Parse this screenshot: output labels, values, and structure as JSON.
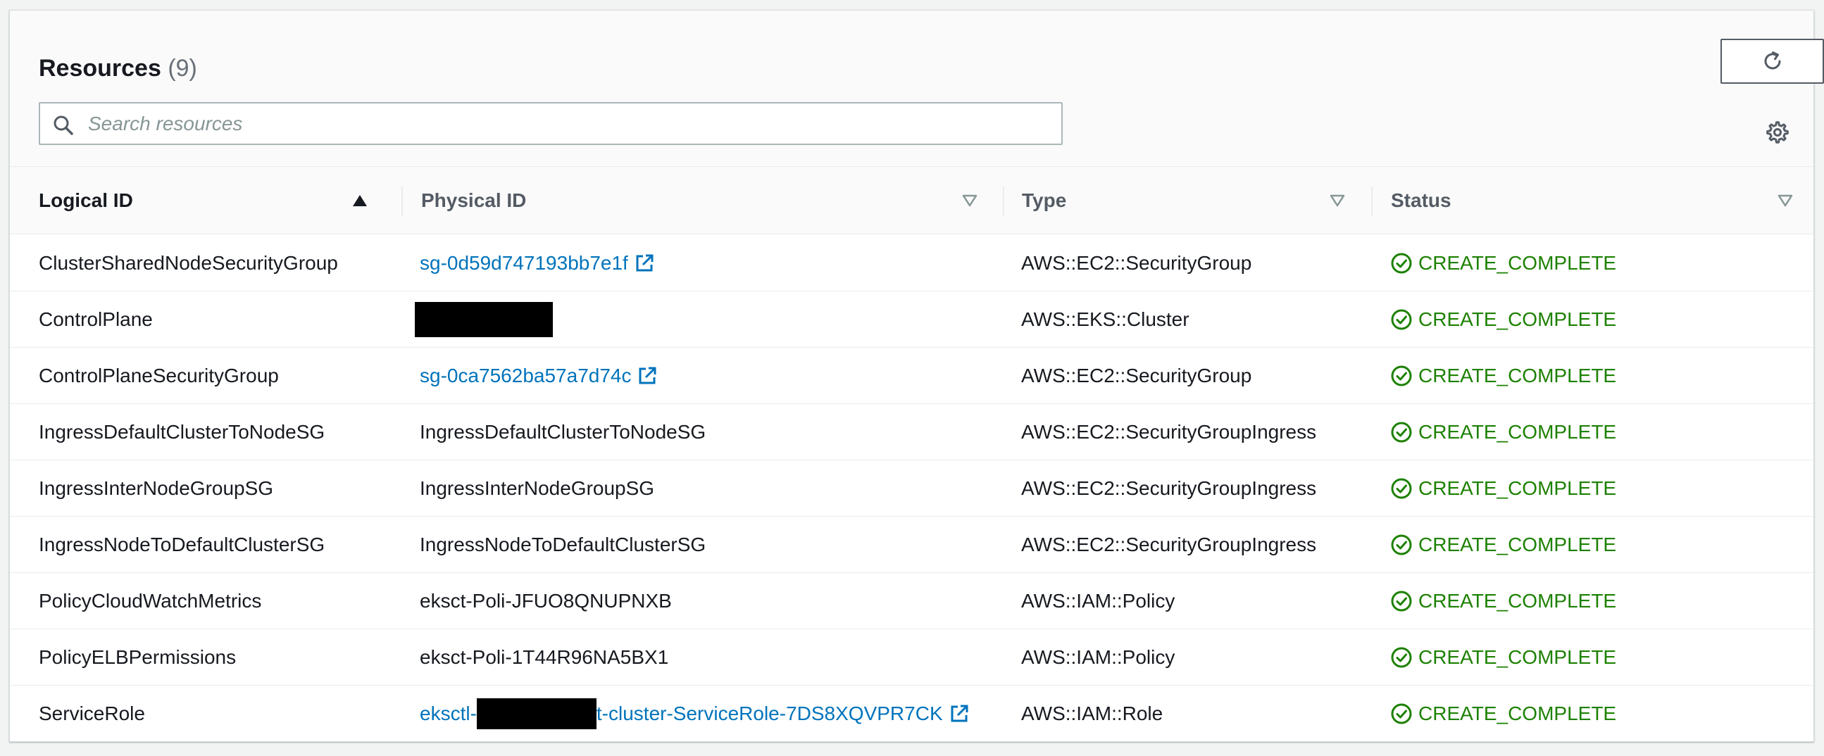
{
  "header": {
    "title": "Resources",
    "count": "(9)"
  },
  "search": {
    "placeholder": "Search resources",
    "value": ""
  },
  "columns": [
    {
      "label": "Logical ID",
      "sort": "ascending"
    },
    {
      "label": "Physical ID",
      "sort": "none"
    },
    {
      "label": "Type",
      "sort": "none"
    },
    {
      "label": "Status",
      "sort": "none"
    }
  ],
  "icons": {
    "refresh": "refresh-icon",
    "search": "search-icon",
    "settings": "gear-icon",
    "external": "external-link-icon",
    "status": "check-circle-icon"
  },
  "colors": {
    "link": "#0073bb",
    "success": "#1d8102"
  },
  "rows": [
    {
      "logical_id": "ClusterSharedNodeSecurityGroup",
      "physical_prefix": "sg-0d59d747193bb7e1f",
      "physical_suffix": "",
      "link": true,
      "redacted": false,
      "type": "AWS::EC2::SecurityGroup",
      "status": "CREATE_COMPLETE"
    },
    {
      "logical_id": "ControlPlane",
      "physical_prefix": "",
      "physical_suffix": "",
      "link": false,
      "redacted": true,
      "type": "AWS::EKS::Cluster",
      "status": "CREATE_COMPLETE"
    },
    {
      "logical_id": "ControlPlaneSecurityGroup",
      "physical_prefix": "sg-0ca7562ba57a7d74c",
      "physical_suffix": "",
      "link": true,
      "redacted": false,
      "type": "AWS::EC2::SecurityGroup",
      "status": "CREATE_COMPLETE"
    },
    {
      "logical_id": "IngressDefaultClusterToNodeSG",
      "physical_prefix": "IngressDefaultClusterToNodeSG",
      "physical_suffix": "",
      "link": false,
      "redacted": false,
      "type": "AWS::EC2::SecurityGroupIngress",
      "status": "CREATE_COMPLETE"
    },
    {
      "logical_id": "IngressInterNodeGroupSG",
      "physical_prefix": "IngressInterNodeGroupSG",
      "physical_suffix": "",
      "link": false,
      "redacted": false,
      "type": "AWS::EC2::SecurityGroupIngress",
      "status": "CREATE_COMPLETE"
    },
    {
      "logical_id": "IngressNodeToDefaultClusterSG",
      "physical_prefix": "IngressNodeToDefaultClusterSG",
      "physical_suffix": "",
      "link": false,
      "redacted": false,
      "type": "AWS::EC2::SecurityGroupIngress",
      "status": "CREATE_COMPLETE"
    },
    {
      "logical_id": "PolicyCloudWatchMetrics",
      "physical_prefix": "eksct-Poli-JFUO8QNUPNXB",
      "physical_suffix": "",
      "link": false,
      "redacted": false,
      "type": "AWS::IAM::Policy",
      "status": "CREATE_COMPLETE"
    },
    {
      "logical_id": "PolicyELBPermissions",
      "physical_prefix": "eksct-Poli-1T44R96NA5BX1",
      "physical_suffix": "",
      "link": false,
      "redacted": false,
      "type": "AWS::IAM::Policy",
      "status": "CREATE_COMPLETE"
    },
    {
      "logical_id": "ServiceRole",
      "physical_prefix": "eksctl-",
      "physical_suffix": "t-cluster-ServiceRole-7DS8XQVPR7CK",
      "link": true,
      "redacted": true,
      "type": "AWS::IAM::Role",
      "status": "CREATE_COMPLETE"
    }
  ]
}
